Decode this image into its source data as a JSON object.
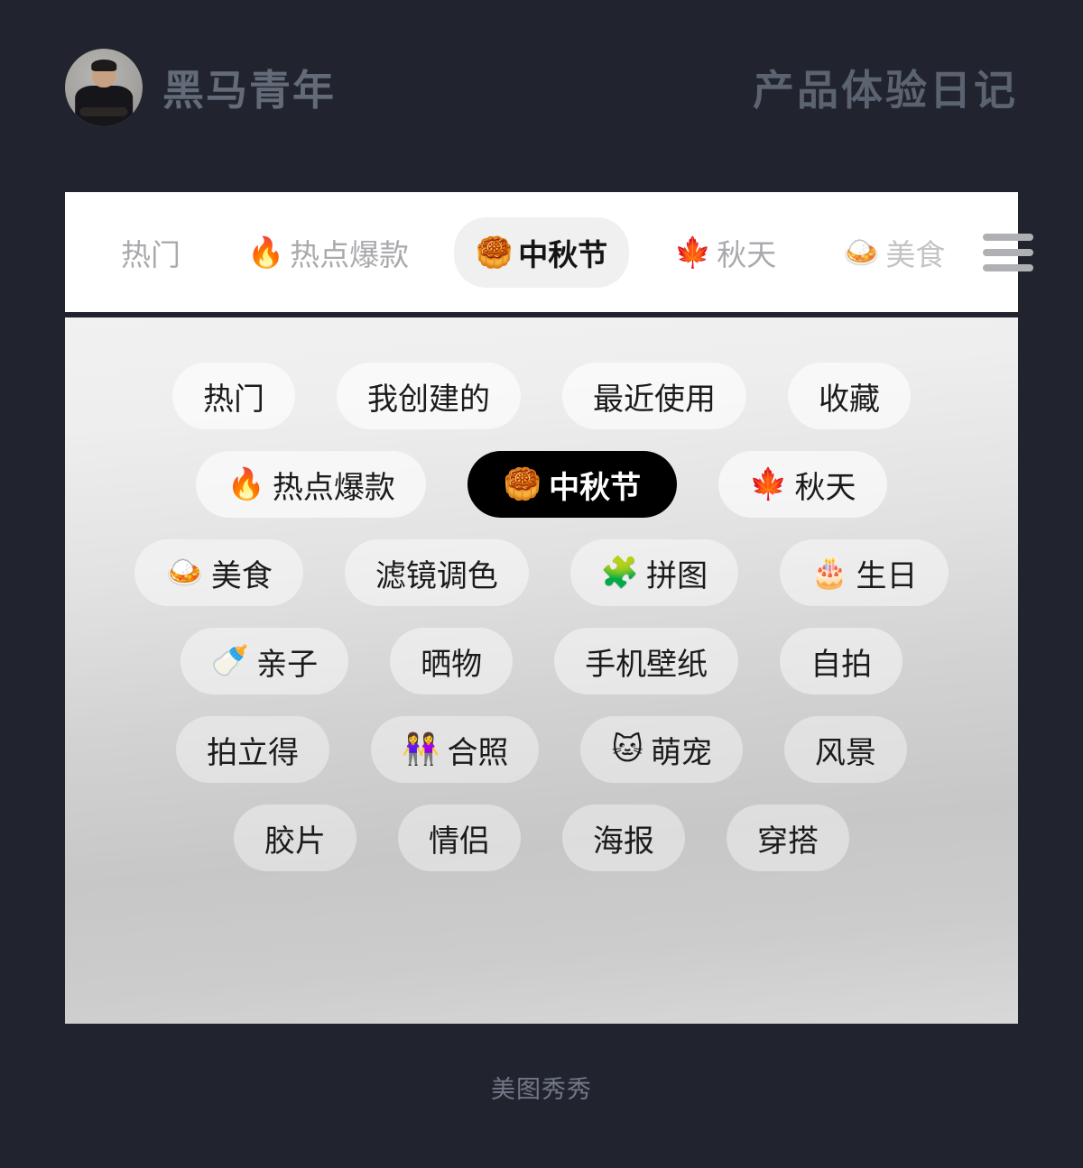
{
  "header": {
    "avatar_name": "avatar-photo",
    "brand_name": "黑马青年",
    "title": "产品体验日记"
  },
  "navbar": {
    "items": [
      {
        "emoji": "",
        "label": "热门",
        "state": "normal"
      },
      {
        "emoji": "🔥",
        "label": "热点爆款",
        "state": "normal"
      },
      {
        "emoji": "🥮",
        "label": "中秋节",
        "state": "active"
      },
      {
        "emoji": "🍁",
        "label": "秋天",
        "state": "normal"
      },
      {
        "emoji": "🍛",
        "label": "美食",
        "state": "faded"
      }
    ],
    "menu_icon": "hamburger-menu-icon"
  },
  "panel": {
    "rows": [
      [
        {
          "emoji": "",
          "label": "热门",
          "selected": false
        },
        {
          "emoji": "",
          "label": "我创建的",
          "selected": false
        },
        {
          "emoji": "",
          "label": "最近使用",
          "selected": false
        },
        {
          "emoji": "",
          "label": "收藏",
          "selected": false
        }
      ],
      [
        {
          "emoji": "🔥",
          "label": "热点爆款",
          "selected": false
        },
        {
          "emoji": "🥮",
          "label": "中秋节",
          "selected": true
        },
        {
          "emoji": "🍁",
          "label": "秋天",
          "selected": false
        }
      ],
      [
        {
          "emoji": "🍛",
          "label": "美食",
          "selected": false
        },
        {
          "emoji": "",
          "label": "滤镜调色",
          "selected": false
        },
        {
          "emoji": "🧩",
          "label": "拼图",
          "selected": false
        },
        {
          "emoji": "🎂",
          "label": "生日",
          "selected": false
        }
      ],
      [
        {
          "emoji": "🍼",
          "label": "亲子",
          "selected": false
        },
        {
          "emoji": "",
          "label": "晒物",
          "selected": false
        },
        {
          "emoji": "",
          "label": "手机壁纸",
          "selected": false
        },
        {
          "emoji": "",
          "label": "自拍",
          "selected": false
        }
      ],
      [
        {
          "emoji": "",
          "label": "拍立得",
          "selected": false
        },
        {
          "emoji": "👭",
          "label": "合照",
          "selected": false
        },
        {
          "emoji": "🐱",
          "label": "萌宠",
          "selected": false
        },
        {
          "emoji": "",
          "label": "风景",
          "selected": false
        }
      ],
      [
        {
          "emoji": "",
          "label": "胶片",
          "selected": false
        },
        {
          "emoji": "",
          "label": "情侣",
          "selected": false
        },
        {
          "emoji": "",
          "label": "海报",
          "selected": false
        },
        {
          "emoji": "",
          "label": "穿搭",
          "selected": false
        }
      ]
    ]
  },
  "footer": {
    "app_name": "美图秀秀"
  },
  "colors": {
    "page_background": "#21242e",
    "navbar_background": "#ffffff",
    "selected_pill": "#000000",
    "header_text": "#636a78",
    "footer_text": "#727888"
  }
}
